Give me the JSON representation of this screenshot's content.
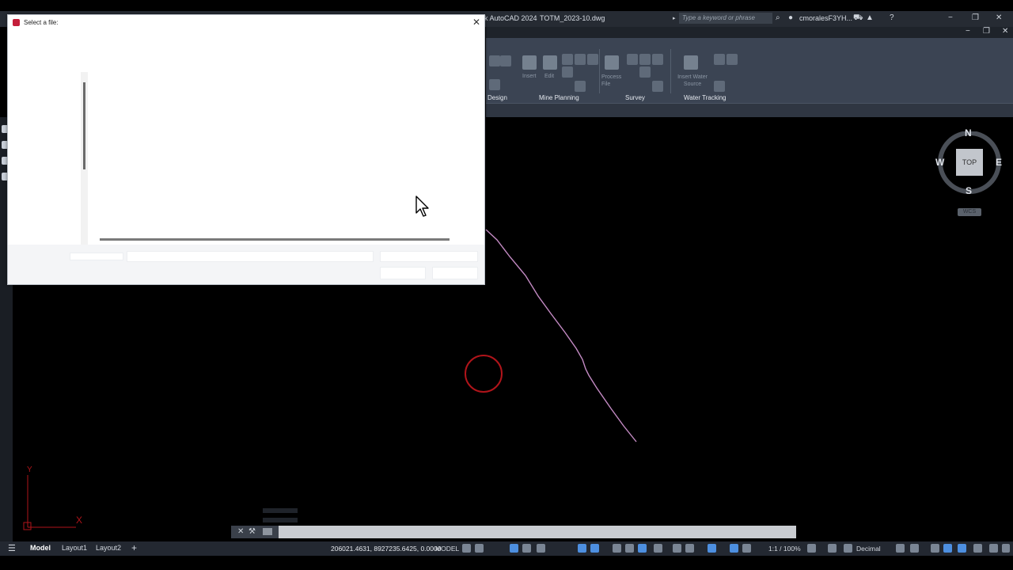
{
  "window": {
    "app_title": "k AutoCAD 2024",
    "file_name": "TOTM_2023-10.dwg",
    "search_placeholder": "Type a keyword or phrase",
    "user": "cmoralesF3YH...",
    "controls": [
      "−",
      "❐",
      "✕"
    ]
  },
  "ribbon": {
    "panels": [
      {
        "label": "Design"
      },
      {
        "label": "Mine Planning"
      },
      {
        "label": "Survey"
      },
      {
        "label": "Water Tracking"
      }
    ],
    "small_labels": {
      "insert": "Insert",
      "edit": "Edit",
      "process_file": "Process File",
      "insert_water_source": "Insert Water Source"
    }
  },
  "viewcube": {
    "north": "N",
    "south": "S",
    "east": "E",
    "west": "W",
    "face": "TOP",
    "wcs": "WCS"
  },
  "ucs": {
    "x": "X",
    "y": "Y"
  },
  "statusbar": {
    "tabs": [
      "Model",
      "Layout1",
      "Layout2"
    ],
    "add_tab": "+",
    "coordinates": "206021.4631, 8927235.6425, 0.0000",
    "space": "MODEL",
    "scale": "1:1 / 100%",
    "units": "Decimal"
  },
  "dialog": {
    "title": "Select a file:",
    "close": "✕"
  },
  "colors": {
    "accent": "#4d8fe0",
    "polyline": "#c48bc4",
    "circle": "#b0141a",
    "ucs": "#b0141a"
  }
}
